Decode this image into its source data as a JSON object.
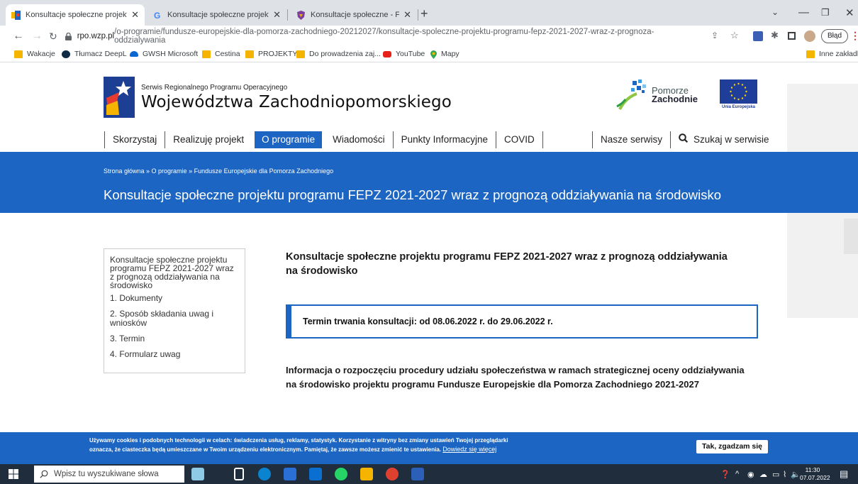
{
  "browser": {
    "tabs": [
      {
        "title": "Konsultacje społeczne projektu p",
        "active": true
      },
      {
        "title": "Konsultacje społeczne projektu p",
        "active": false
      },
      {
        "title": "Konsultacje społeczne - Fundusz",
        "active": false
      }
    ],
    "new_tab": "+",
    "url_host": "rpo.wzp.pl",
    "url_path": "/o-programie/fundusze-europejskie-dla-pomorza-zachodniego-20212027/konsultacje-spoleczne-projektu-programu-fepz-2021-2027-wraz-z-prognoza-oddzialywania",
    "profile_button": "Błąd",
    "bookmarks": [
      {
        "label": "Wakacje",
        "icon": "folder-icon"
      },
      {
        "label": "Tłumacz DeepL",
        "icon": "deepl-icon"
      },
      {
        "label": "GWSH Microsoft",
        "icon": "onedrive-icon"
      },
      {
        "label": "Cestina",
        "icon": "folder-icon"
      },
      {
        "label": "PROJEKTY",
        "icon": "folder-icon"
      },
      {
        "label": "Do prowadzenia zaj...",
        "icon": "folder-icon"
      },
      {
        "label": "YouTube",
        "icon": "youtube-icon"
      },
      {
        "label": "Mapy",
        "icon": "maps-icon"
      }
    ],
    "other_bookmarks": "Inne zakładki"
  },
  "site": {
    "subtitle": "Serwis Regionalnego Programu Operacyjnego",
    "title": "Województwa Zachodniopomorskiego",
    "pz_line1": "Pomorze",
    "pz_line2": "Zachodnie",
    "eu_label": "Unia Europejska"
  },
  "nav": {
    "items": [
      "Skorzystaj",
      "Realizuję projekt",
      "O programie",
      "Wiadomości",
      "Punkty Informacyjne",
      "COVID"
    ],
    "active_index": 2,
    "services": "Nasze serwisy",
    "search": "Szukaj w serwisie"
  },
  "hero": {
    "breadcrumb": "Strona główna » O programie » Fundusze Europejskie dla Pomorza Zachodniego",
    "title": "Konsultacje społeczne projektu programu FEPZ 2021-2027 wraz z prognozą oddziaływania na środowisko"
  },
  "sidebar": {
    "heading": "Konsultacje społeczne projektu programu FEPZ 2021-2027 wraz z prognozą oddziaływania na środowisko",
    "links": [
      "1. Dokumenty",
      "2. Sposób składania uwag i wniosków",
      "3. Termin",
      "4. Formularz uwag"
    ]
  },
  "content": {
    "title": "Konsultacje społeczne projektu programu FEPZ 2021-2027 wraz z prognozą oddziaływania na środowisko",
    "term": "Termin trwania konsultacji: od 08.06.2022 r. do 29.06.2022 r.",
    "info": "Informacja o rozpoczęciu procedury udziału społeczeństwa w ramach strategicznej oceny oddziaływania na środowisko projektu programu Fundusze Europejskie dla Pomorza Zachodniego 2021-2027"
  },
  "cookie": {
    "text": "Używamy cookies i podobnych technologii w celach: świadczenia usług, reklamy, statystyk. Korzystanie z witryny bez zmiany ustawień Twojej przeglądarki oznacza, że ciasteczka będą umieszczane w Twoim urządzeniu elektronicznym. Pamiętaj, że zawsze możesz zmienić te ustawienia.",
    "link": "Dowiedz się więcej",
    "accept": "Tak, zgadzam się"
  },
  "taskbar": {
    "search_placeholder": "Wpisz tu wyszukiwane słowa",
    "time": "11:30",
    "date": "07.07.2022"
  },
  "colors": {
    "brand_blue": "#1c65c2",
    "tab_strip": "#dee1e6",
    "taskbar": "#1f2d3d"
  }
}
